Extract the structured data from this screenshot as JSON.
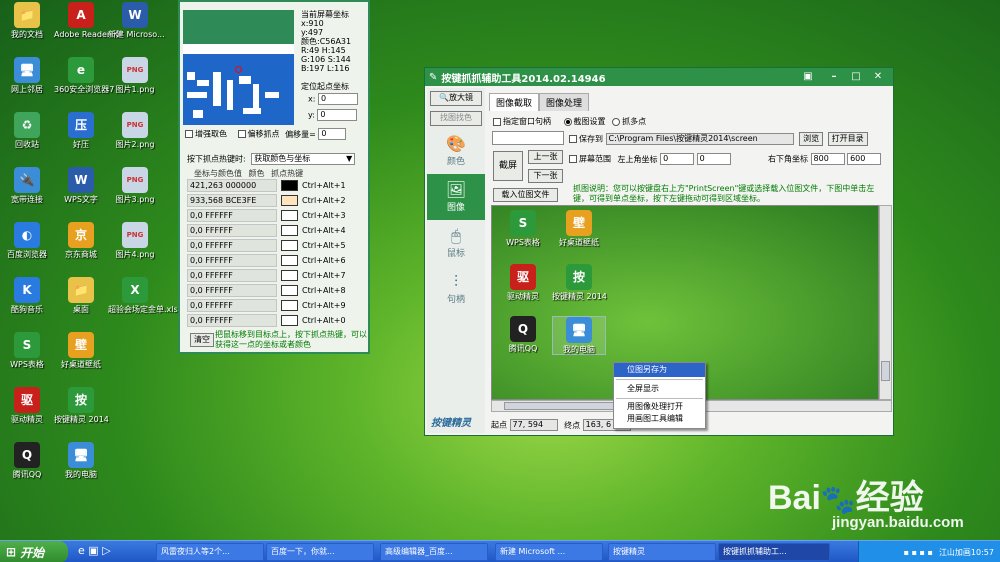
{
  "desktop_icons": [
    {
      "label": "我的文档",
      "color": "#e9c24a",
      "glyph": "📁"
    },
    {
      "label": "Adobe Reader XI",
      "color": "#c8201b",
      "glyph": "A"
    },
    {
      "label": "新建 Microso...",
      "color": "#2b5caa",
      "glyph": "W"
    },
    {
      "label": "网上邻居",
      "color": "#3c8dd8",
      "glyph": "🖥"
    },
    {
      "label": "360安全浏览器7",
      "color": "#2c9a3a",
      "glyph": "e"
    },
    {
      "label": "图片1.png",
      "color": "#c9d6e6",
      "glyph": "PNG"
    },
    {
      "label": "回收站",
      "color": "#3fa55a",
      "glyph": "♻"
    },
    {
      "label": "好压",
      "color": "#2a6fd0",
      "glyph": "压"
    },
    {
      "label": "图片2.png",
      "color": "#c9d6e6",
      "glyph": "PNG"
    },
    {
      "label": "宽带连接",
      "color": "#3c8dd8",
      "glyph": "🔌"
    },
    {
      "label": "WPS文字",
      "color": "#2b5caa",
      "glyph": "W"
    },
    {
      "label": "图片3.png",
      "color": "#c9d6e6",
      "glyph": "PNG"
    },
    {
      "label": "百度浏览器",
      "color": "#2a7be0",
      "glyph": "◐"
    },
    {
      "label": "京东商城",
      "color": "#e8a020",
      "glyph": "京"
    },
    {
      "label": "图片4.png",
      "color": "#c9d6e6",
      "glyph": "PNG"
    },
    {
      "label": "酷狗音乐",
      "color": "#2a7be0",
      "glyph": "K"
    },
    {
      "label": "桌面",
      "color": "#e9c24a",
      "glyph": "📁"
    },
    {
      "label": "超验会场定金单.xls",
      "color": "#2c9a3a",
      "glyph": "X"
    },
    {
      "label": "WPS表格",
      "color": "#2c9a3a",
      "glyph": "S"
    },
    {
      "label": "好桌道壁纸",
      "color": "#e8a020",
      "glyph": "壁"
    },
    {
      "label": "驱动精灵",
      "color": "#c8201b",
      "glyph": "驱"
    },
    {
      "label": "按键精灵 2014",
      "color": "#2c9a3a",
      "glyph": "按"
    },
    {
      "label": "腾讯QQ",
      "color": "#222",
      "glyph": "Q"
    },
    {
      "label": "我的电脑",
      "color": "#3c8dd8",
      "glyph": "🖥"
    }
  ],
  "picker": {
    "title": "",
    "info_lines": [
      "当前屏幕坐标",
      "x:910",
      "y:497",
      "颜色:C56A31",
      "R:49  H:145",
      "G:106  S:144",
      "B:197  L:116"
    ],
    "origin_label": "定位起点坐标",
    "x_label": "x:",
    "x_val": "0",
    "y_label": "y:",
    "y_val": "0",
    "chk_enhance": "增强取色",
    "chk_offset": "偏移抓点",
    "offset_label": "偏移量=",
    "offset_val": "0",
    "hotkey_label": "按下抓点热键时:",
    "hotkey_value": "获取颜色与坐标",
    "col1": "坐标与颜色值",
    "col2": "颜色",
    "col3": "抓点热键",
    "rows": [
      {
        "v": "421,263  000000",
        "c": "#000000",
        "k": "Ctrl+Alt+1"
      },
      {
        "v": "933,568  BCE3FE",
        "c": "#FEE3BC",
        "k": "Ctrl+Alt+2"
      },
      {
        "v": "0,0  FFFFFF",
        "c": "#FFFFFF",
        "k": "Ctrl+Alt+3"
      },
      {
        "v": "0,0  FFFFFF",
        "c": "#FFFFFF",
        "k": "Ctrl+Alt+4"
      },
      {
        "v": "0,0  FFFFFF",
        "c": "#FFFFFF",
        "k": "Ctrl+Alt+5"
      },
      {
        "v": "0,0  FFFFFF",
        "c": "#FFFFFF",
        "k": "Ctrl+Alt+6"
      },
      {
        "v": "0,0  FFFFFF",
        "c": "#FFFFFF",
        "k": "Ctrl+Alt+7"
      },
      {
        "v": "0,0  FFFFFF",
        "c": "#FFFFFF",
        "k": "Ctrl+Alt+8"
      },
      {
        "v": "0,0  FFFFFF",
        "c": "#FFFFFF",
        "k": "Ctrl+Alt+9"
      },
      {
        "v": "0,0  FFFFFF",
        "c": "#FFFFFF",
        "k": "Ctrl+Alt+0"
      }
    ],
    "clear_btn": "清空",
    "tip": "把鼠标移到目标点上，按下抓点热键，可以获得这一点的坐标或者颜色"
  },
  "tool": {
    "title": "按键抓抓辅助工具2014.02.14946",
    "side": [
      {
        "label": "放大镜",
        "top": true
      },
      {
        "label": "找图找色",
        "top": true
      },
      {
        "label": "颜色",
        "ico": "🎨"
      },
      {
        "label": "图像",
        "ico": "🖼"
      },
      {
        "label": "鼠标",
        "ico": "🖱"
      },
      {
        "label": "句柄",
        "ico": "⚙"
      }
    ],
    "brand": "按键精灵",
    "tabs": [
      "图像截取",
      "图像处理"
    ],
    "chk_window": "指定窗口句柄",
    "radio_capture": "截图设置",
    "radio_multi": "抓多点",
    "chk_save": "保存到",
    "save_path": "C:\\Program Files\\按键精灵2014\\screen",
    "browse_btn": "浏览",
    "open_dir_btn": "打开目录",
    "capture_btn": "截屏",
    "prev_btn": "上一张",
    "next_btn": "下一张",
    "chk_range": "屏幕范围",
    "topleft_label": "左上角坐标",
    "tl_x": "0",
    "tl_y": "0",
    "bottomright_label": "右下角坐标",
    "br_x": "800",
    "br_y": "600",
    "load_btn": "载入位图文件",
    "help": "抓图说明：您可以按键盘右上方\"PrintScreen\"键或选择载入位图文件，下图中单击左键，可得到单点坐标，按下左键拖动可得到区域坐标。",
    "preview_icons": [
      {
        "label": "WPS表格",
        "color": "#2c9a3a",
        "glyph": "S"
      },
      {
        "label": "好桌道壁纸",
        "color": "#e8a020",
        "glyph": "壁"
      },
      {
        "label": "驱动精灵",
        "color": "#c8201b",
        "glyph": "驱"
      },
      {
        "label": "按键精灵 2014",
        "color": "#2c9a3a",
        "glyph": "按"
      },
      {
        "label": "腾讯QQ",
        "color": "#222",
        "glyph": "Q"
      },
      {
        "label": "我的电脑",
        "color": "#3c8dd8",
        "glyph": "🖥"
      }
    ],
    "start_label": "起点",
    "start_val": "77, 594",
    "end_label": "终点",
    "end_val": "163, 6"
  },
  "context_menu": [
    "位图另存为",
    "全屏显示",
    "用图像处理打开",
    "用画图工具编辑"
  ],
  "taskbar": {
    "start": "开始",
    "tasks": [
      "风雷夜归人等2个...",
      "百度一下，你就...",
      "高级编辑器_百度...",
      "新建 Microsoft ...",
      "按键精灵",
      "按键抓抓辅助工..."
    ],
    "clock": "江山加画10:57"
  },
  "watermark": {
    "brand": "Bai",
    "brand2": "经验",
    "url": "jingyan.baidu.com"
  }
}
